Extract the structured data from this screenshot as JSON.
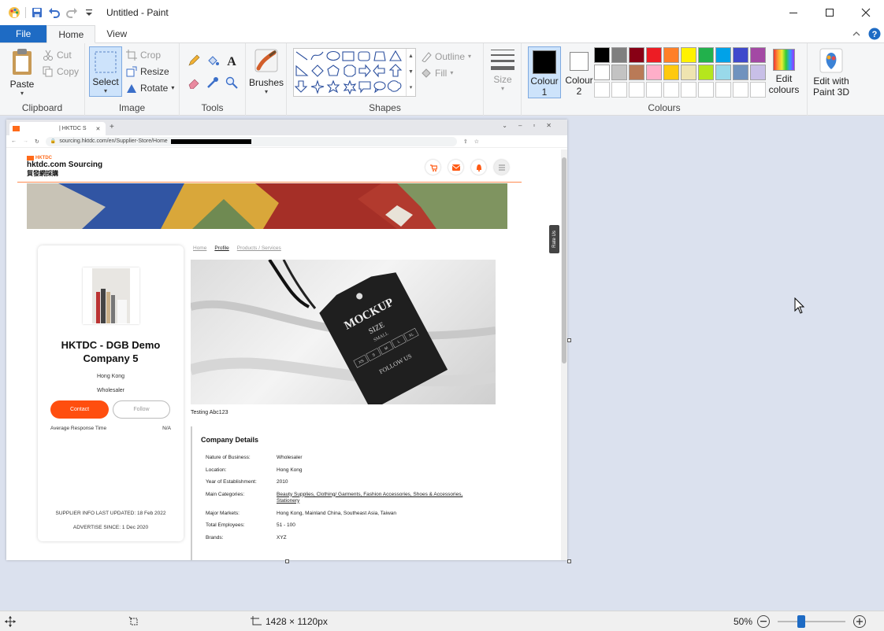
{
  "window": {
    "title": "Untitled - Paint",
    "minimize": "—",
    "maximize": "☐",
    "close": "✕"
  },
  "tabs": {
    "file": "File",
    "home": "Home",
    "view": "View"
  },
  "ribbon": {
    "clipboard": {
      "paste": "Paste",
      "cut": "Cut",
      "copy": "Copy",
      "label": "Clipboard"
    },
    "image": {
      "select": "Select",
      "crop": "Crop",
      "resize": "Resize",
      "rotate": "Rotate",
      "label": "Image"
    },
    "tools": {
      "label": "Tools"
    },
    "brushes": {
      "label": "Brushes"
    },
    "shapes": {
      "outline": "Outline",
      "fill": "Fill",
      "label": "Shapes"
    },
    "size": {
      "label": "Size"
    },
    "colours": {
      "colour1": "Colour",
      "colour1_num": "1",
      "colour2": "Colour",
      "colour2_num": "2",
      "edit_colours_1": "Edit",
      "edit_colours_2": "colours",
      "paint3d_1": "Edit with",
      "paint3d_2": "Paint 3D",
      "label": "Colours",
      "palette_row1": [
        "#000000",
        "#7f7f7f",
        "#880015",
        "#ed1c24",
        "#ff7f27",
        "#fff200",
        "#22b14c",
        "#00a2e8",
        "#3f48cc",
        "#a349a4"
      ],
      "palette_row2": [
        "#ffffff",
        "#c3c3c3",
        "#b97a57",
        "#ffaec9",
        "#ffc90e",
        "#efe4b0",
        "#b5e61d",
        "#99d9ea",
        "#7092be",
        "#c8bfe7"
      ]
    }
  },
  "browser": {
    "tab_title": "| HKTDC S",
    "tab_close": "✕",
    "new_tab": "+",
    "url": "sourcing.hktdc.com/en/Supplier-Store/Home"
  },
  "site": {
    "logo_brand": "HKTDC",
    "logo_name": "hktdc.com Sourcing",
    "logo_cn": "貿發網採購",
    "rate_us": "Rate Us",
    "breadcrumb": [
      "Home",
      "Profile",
      "Products / Services"
    ],
    "company_name": "HKTDC - DGB Demo Company 5",
    "company_location": "Hong Kong",
    "company_type": "Wholesaler",
    "contact_btn": "Contact",
    "follow_btn": "Follow",
    "avg_response_label": "Average Response Time",
    "avg_response_value": "N/A",
    "supplier_updated": "SUPPLIER INFO LAST UPDATED: 18 Feb 2022",
    "advertise_since": "ADVERTISE SINCE: 1 Dec 2020",
    "caption": "Testing Abc123",
    "details_title": "Company Details",
    "details": [
      {
        "label": "Nature of Business:",
        "value": "Wholesaler"
      },
      {
        "label": "Location:",
        "value": "Hong Kong"
      },
      {
        "label": "Year of Establishment:",
        "value": "2010"
      },
      {
        "label": "Main Categories:",
        "value": "Beauty Supplies, Clothing/ Garments, Fashion Accessories, Shoes & Accessories, Stationery"
      },
      {
        "label": "Major Markets:",
        "value": "Hong Kong, Mainland China, Southeast Asia, Taiwan"
      },
      {
        "label": "Total Employees:",
        "value": "51 - 100"
      },
      {
        "label": "Brands:",
        "value": "XYZ"
      }
    ],
    "tag_text": "MOCKUP",
    "tag_size": "SIZE",
    "tag_small": "SMALL",
    "tag_sizes": [
      "XS",
      "S",
      "M",
      "L",
      "XL"
    ],
    "tag_follow": "FOLLOW US"
  },
  "status": {
    "dimensions": "1428 × 1120px",
    "zoom": "50%",
    "zoom_fraction": 0.35
  }
}
